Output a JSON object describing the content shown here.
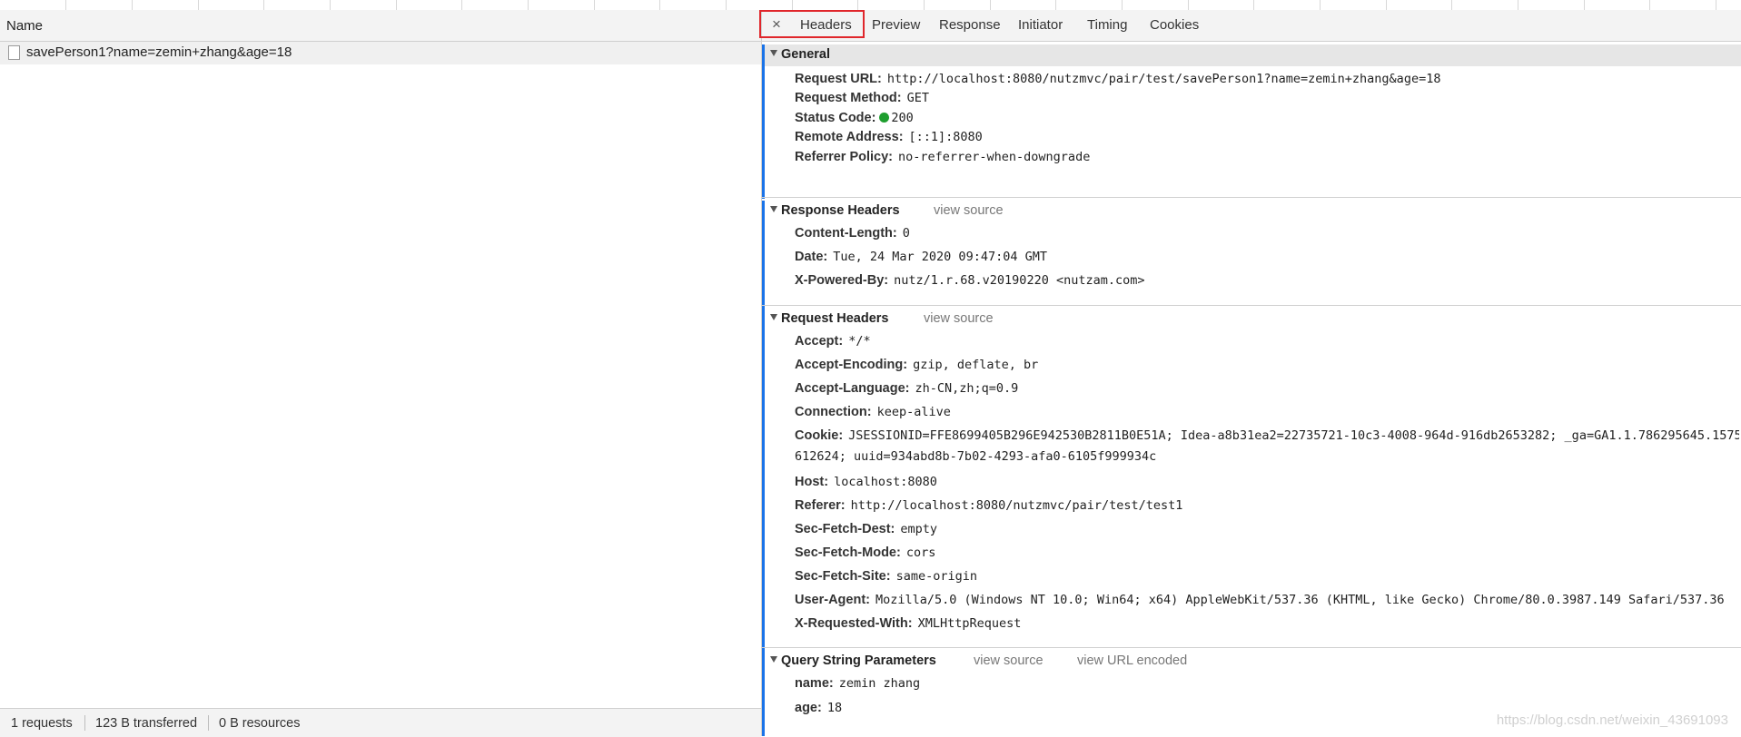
{
  "left": {
    "column_name": "Name",
    "request_name": "savePerson1?name=zemin+zhang&age=18",
    "status": [
      "1 requests",
      "123 B transferred",
      "0 B resources"
    ]
  },
  "tabs": {
    "close_glyph": "×",
    "items": [
      "Headers",
      "Preview",
      "Response",
      "Initiator",
      "Timing",
      "Cookies"
    ],
    "active": "Headers",
    "highlight_color": "#e0262b"
  },
  "general": {
    "title": "General",
    "rows": [
      {
        "key": "Request URL:",
        "value": "http://localhost:8080/nutzmvc/pair/test/savePerson1?name=zemin+zhang&age=18"
      },
      {
        "key": "Request Method:",
        "value": "GET"
      },
      {
        "key": "Status Code:",
        "value": "200"
      },
      {
        "key": "Remote Address:",
        "value": "[::1]:8080"
      },
      {
        "key": "Referrer Policy:",
        "value": "no-referrer-when-downgrade"
      }
    ],
    "status_color": "#1e9e2e"
  },
  "response_headers": {
    "title": "Response Headers",
    "view_source": "view source",
    "rows": [
      {
        "key": "Content-Length:",
        "value": "0"
      },
      {
        "key": "Date:",
        "value": "Tue, 24 Mar 2020 09:47:04 GMT"
      },
      {
        "key": "X-Powered-By:",
        "value": "nutz/1.r.68.v20190220 <nutzam.com>"
      }
    ]
  },
  "request_headers": {
    "title": "Request Headers",
    "view_source": "view source",
    "rows": [
      {
        "key": "Accept:",
        "value": "*/*"
      },
      {
        "key": "Accept-Encoding:",
        "value": "gzip, deflate, br"
      },
      {
        "key": "Accept-Language:",
        "value": "zh-CN,zh;q=0.9"
      },
      {
        "key": "Connection:",
        "value": "keep-alive"
      },
      {
        "key": "Cookie:",
        "value": "JSESSIONID=FFE8699405B296E942530B2811B0E51A; Idea-a8b31ea2=22735721-10c3-4008-964d-916db2653282; _ga=GA1.1.786295645.1575"
      },
      {
        "key": "Host:",
        "value": "localhost:8080"
      },
      {
        "key": "Referer:",
        "value": "http://localhost:8080/nutzmvc/pair/test/test1"
      },
      {
        "key": "Sec-Fetch-Dest:",
        "value": "empty"
      },
      {
        "key": "Sec-Fetch-Mode:",
        "value": "cors"
      },
      {
        "key": "Sec-Fetch-Site:",
        "value": "same-origin"
      },
      {
        "key": "User-Agent:",
        "value": "Mozilla/5.0 (Windows NT 10.0; Win64; x64) AppleWebKit/537.36 (KHTML, like Gecko) Chrome/80.0.3987.149 Safari/537.36"
      },
      {
        "key": "X-Requested-With:",
        "value": "XMLHttpRequest"
      }
    ],
    "cookie_continuation": "612624; uuid=934abd8b-7b02-4293-afa0-6105f999934c"
  },
  "query_params": {
    "title": "Query String Parameters",
    "view_source": "view source",
    "view_url_encoded": "view URL encoded",
    "rows": [
      {
        "key": "name:",
        "value": "zemin zhang"
      },
      {
        "key": "age:",
        "value": "18"
      }
    ]
  },
  "watermark": "https://blog.csdn.net/weixin_43691093"
}
